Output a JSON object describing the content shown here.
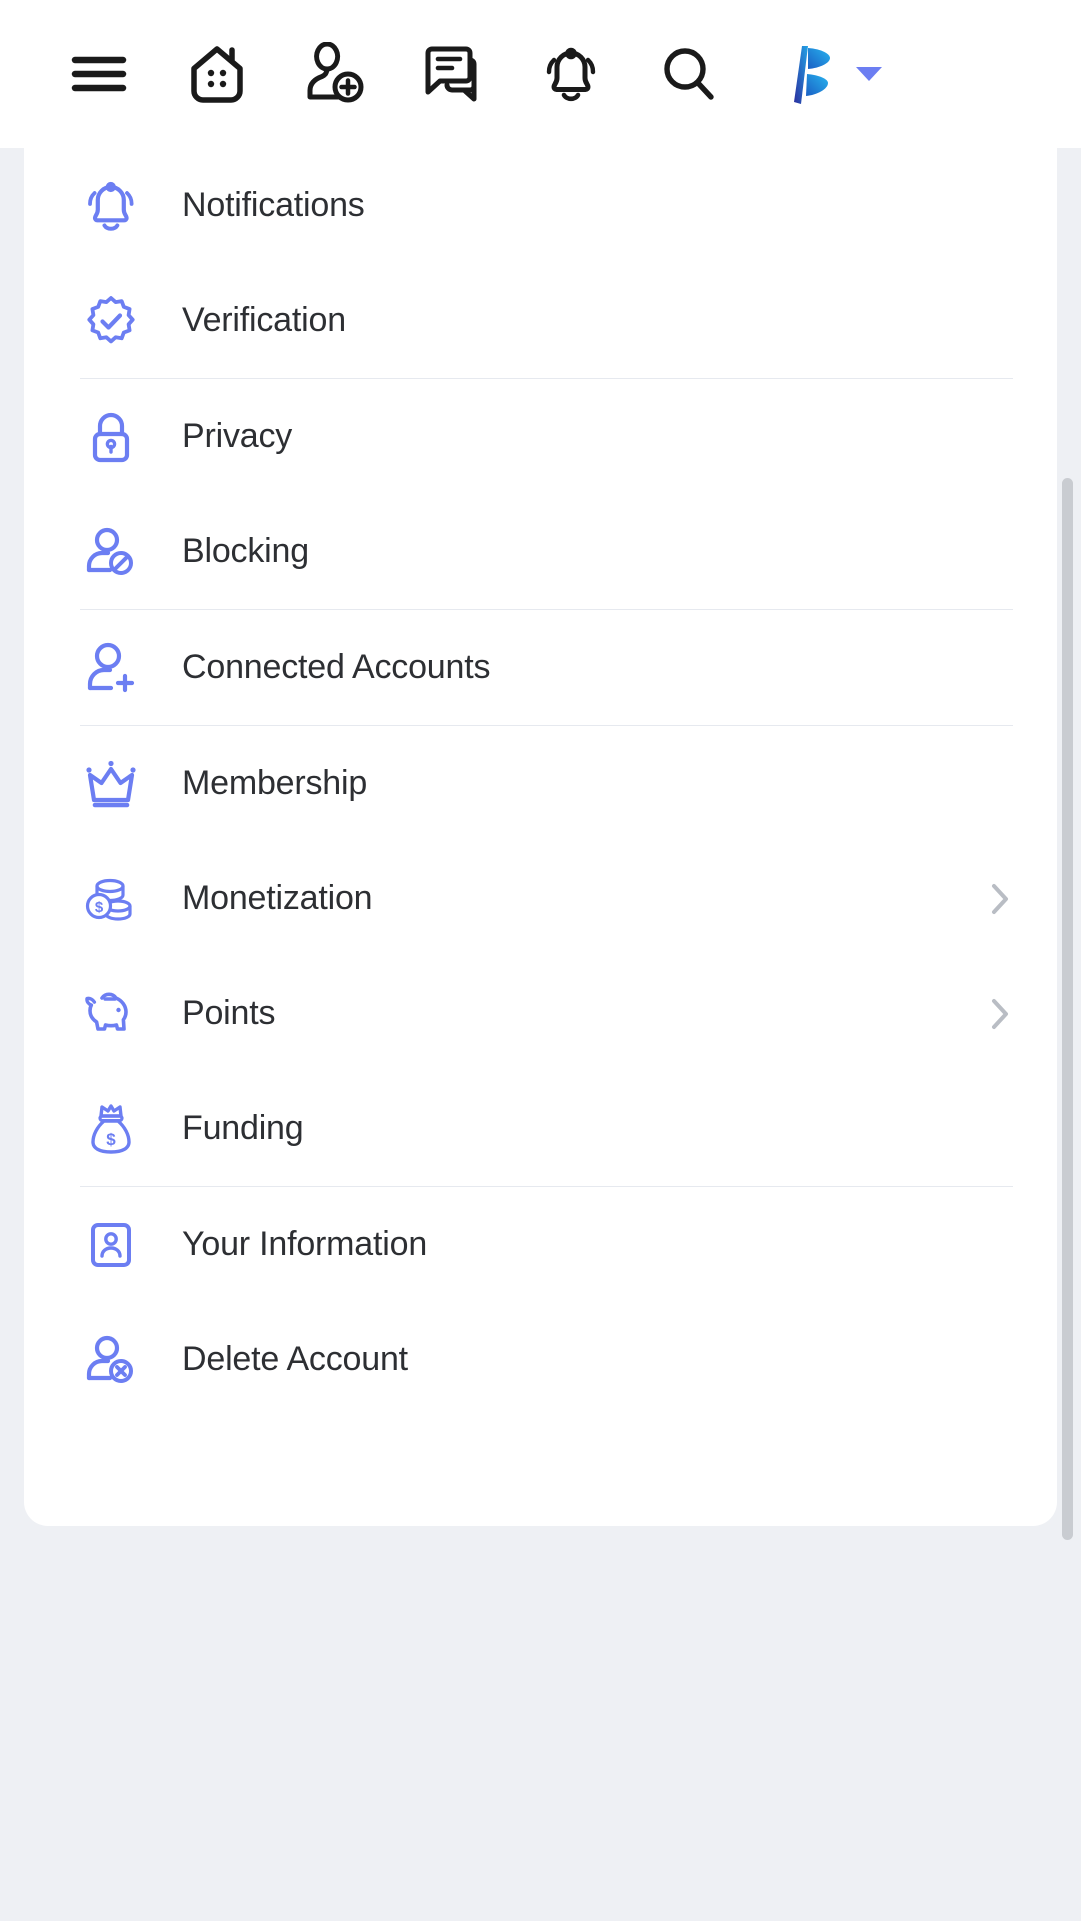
{
  "topbar": {
    "icons": [
      {
        "name": "hamburger-menu-icon",
        "label": "Menu"
      },
      {
        "name": "home-icon",
        "label": "Home"
      },
      {
        "name": "add-person-icon",
        "label": "Add Friend"
      },
      {
        "name": "chat-icon",
        "label": "Messages"
      },
      {
        "name": "bell-icon",
        "label": "Notifications"
      },
      {
        "name": "search-icon",
        "label": "Search"
      }
    ],
    "brand": {
      "logo_name": "brand-logo-icon",
      "caret_name": "chevron-down-icon",
      "logo_color_start": "#1fa7e8",
      "logo_color_end": "#2b2e9e",
      "caret_color": "#6c7ef2"
    }
  },
  "settings": {
    "icon_color": "#6c7ef2",
    "text_color": "#2d2f33",
    "divider_color": "#e6e9ef",
    "chevron_color": "#b9bdc4",
    "groups": [
      {
        "items": [
          {
            "label": "Notifications",
            "icon": "bell-icon",
            "chevron": false
          },
          {
            "label": "Verification",
            "icon": "verified-badge-icon",
            "chevron": false
          }
        ]
      },
      {
        "items": [
          {
            "label": "Privacy",
            "icon": "lock-icon",
            "chevron": false
          },
          {
            "label": "Blocking",
            "icon": "person-blocked-icon",
            "chevron": false
          }
        ]
      },
      {
        "items": [
          {
            "label": "Connected Accounts",
            "icon": "person-add-icon",
            "chevron": false
          }
        ]
      },
      {
        "items": [
          {
            "label": "Membership",
            "icon": "crown-icon",
            "chevron": false
          },
          {
            "label": "Monetization",
            "icon": "coins-icon",
            "chevron": true
          },
          {
            "label": "Points",
            "icon": "piggy-bank-icon",
            "chevron": true
          },
          {
            "label": "Funding",
            "icon": "money-bag-icon",
            "chevron": false
          }
        ]
      },
      {
        "items": [
          {
            "label": "Your Information",
            "icon": "id-card-icon",
            "chevron": false
          },
          {
            "label": "Delete Account",
            "icon": "person-delete-icon",
            "chevron": false
          }
        ]
      }
    ]
  },
  "scrollbar": {
    "name": "vertical-scrollbar",
    "thumb_color": "#c9ccd1"
  }
}
